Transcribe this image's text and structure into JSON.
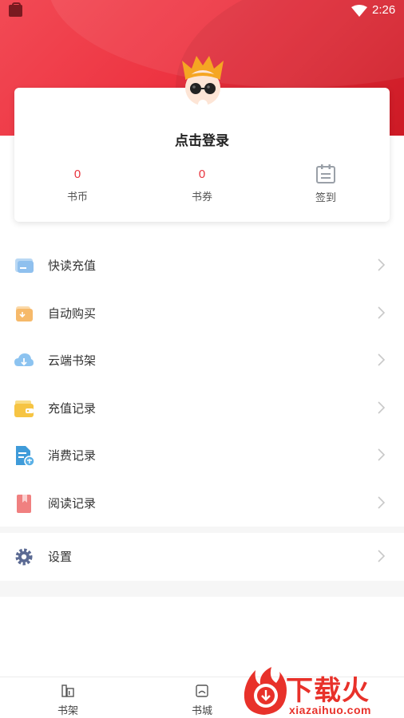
{
  "status_bar": {
    "time": "2:26"
  },
  "profile": {
    "login_text": "点击登录",
    "stats": [
      {
        "value": "0",
        "label": "书币"
      },
      {
        "value": "0",
        "label": "书券"
      },
      {
        "label": "签到",
        "icon": "calendar-icon"
      }
    ]
  },
  "menu": {
    "items": [
      {
        "label": "快读充值",
        "icon": "card-icon",
        "color": "#9fc7ee"
      },
      {
        "label": "自动购买",
        "icon": "wallet-download-icon",
        "color": "#f6b96a"
      },
      {
        "label": "云端书架",
        "icon": "cloud-download-icon",
        "color": "#7ab8ee"
      },
      {
        "label": "充值记录",
        "icon": "wallet-icon",
        "color": "#f6c443"
      },
      {
        "label": "消费记录",
        "icon": "document-icon",
        "color": "#3f9bd9"
      },
      {
        "label": "阅读记录",
        "icon": "bookmark-icon",
        "color": "#f08080"
      }
    ],
    "settings": {
      "label": "设置",
      "icon": "gear-icon",
      "color": "#5b6a93"
    }
  },
  "tabbar": {
    "items": [
      {
        "label": "书架",
        "icon": "bookshelf-icon"
      },
      {
        "label": "书城",
        "icon": "bookstore-icon"
      }
    ]
  },
  "watermark": {
    "brand": "下载火",
    "url": "xiazaihuo.com"
  },
  "colors": {
    "accent": "#e8333d",
    "hero": "#ec2f3d",
    "divider": "#f6f6f6"
  }
}
